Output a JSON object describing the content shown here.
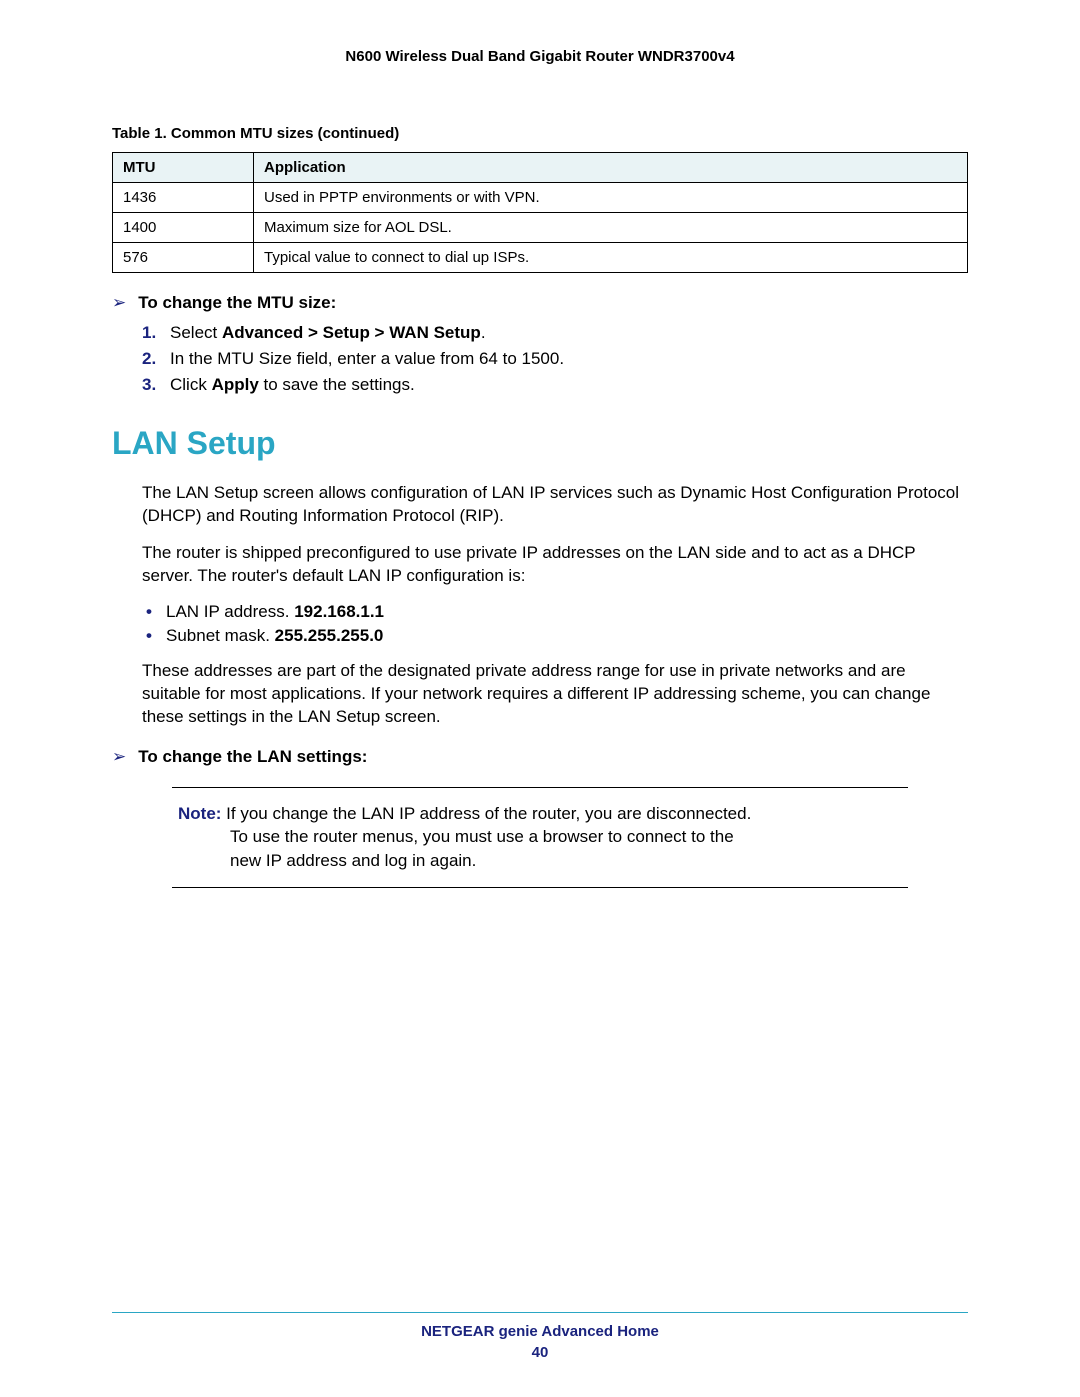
{
  "header": {
    "title": "N600 Wireless Dual Band Gigabit Router WNDR3700v4"
  },
  "table": {
    "caption": "Table 1.  Common MTU sizes  (continued)",
    "headers": [
      "MTU",
      "Application"
    ],
    "rows": [
      {
        "mtu": "1436",
        "app": "Used in PPTP environments or with VPN."
      },
      {
        "mtu": "1400",
        "app": "Maximum size for AOL DSL."
      },
      {
        "mtu": "576",
        "app": "Typical value to connect to dial up ISPs."
      }
    ]
  },
  "proc1": {
    "heading": "To change the MTU size:",
    "steps": {
      "s1": {
        "num": "1.",
        "pre": "Select ",
        "bold": "Advanced > Setup > WAN Setup",
        "post": "."
      },
      "s2": {
        "num": "2.",
        "text": "In the MTU Size field, enter a value from 64 to 1500."
      },
      "s3": {
        "num": "3.",
        "pre": "Click ",
        "bold": "Apply",
        "post": " to save the settings."
      }
    }
  },
  "section": {
    "heading": "LAN Setup"
  },
  "para1": "The LAN Setup screen allows configuration of LAN IP services such as Dynamic Host Configuration Protocol (DHCP) and Routing Information Protocol (RIP).",
  "para2": "The router is shipped preconfigured to use private IP addresses on the LAN side and to act as a DHCP server. The router's default LAN IP configuration is:",
  "bullets": {
    "b1": {
      "label": "LAN IP address. ",
      "bold": "192.168.1.1"
    },
    "b2": {
      "label": "Subnet mask. ",
      "bold": "255.255.255.0"
    }
  },
  "para3": "These addresses are part of the designated private address range for use in private networks and are suitable for most applications. If your network requires a different IP addressing scheme, you can change these settings in the LAN Setup screen.",
  "proc2": {
    "heading": "To change the LAN settings:"
  },
  "note": {
    "label": "Note:  ",
    "line1": "If you change the LAN IP address of the router, you are disconnected.",
    "line2": "To use the router menus, you must use a browser to connect to the",
    "line3": "new IP address and log in again."
  },
  "footer": {
    "line1": "NETGEAR genie Advanced Home",
    "page": "40"
  }
}
